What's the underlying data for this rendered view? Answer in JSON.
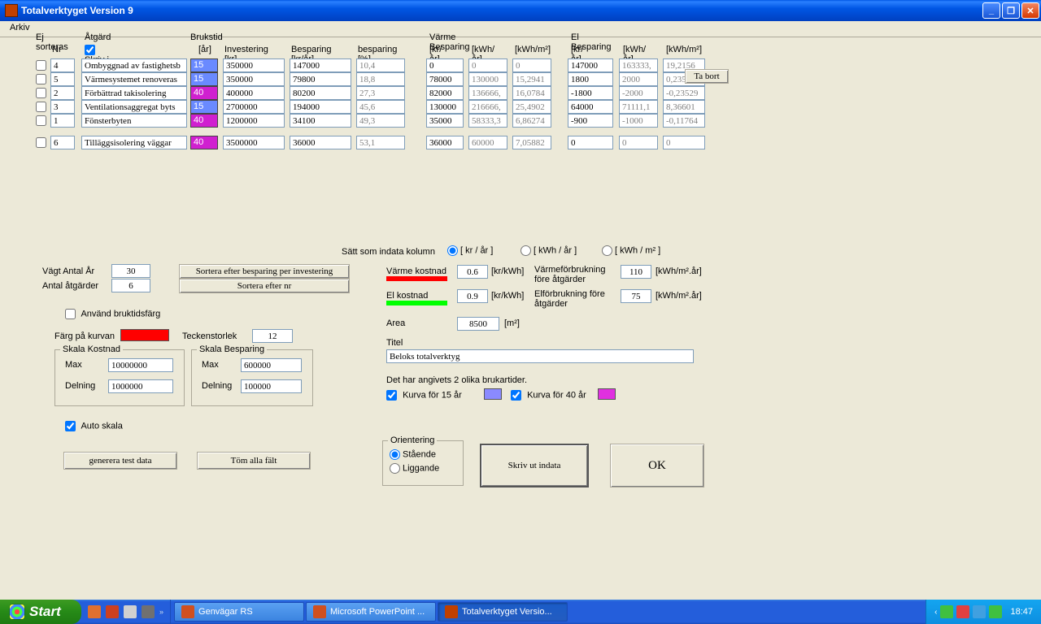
{
  "titlebar": {
    "text": "Totalverktyget Version 9"
  },
  "menu": {
    "arkiv": "Arkiv"
  },
  "headers": {
    "ej_sorteras": "Ej sorteras",
    "nr": "Nr",
    "atgard": "Åtgärd",
    "skriv_i_diagram": "Skriv i diagram",
    "brukstid": "Brukstid",
    "brukstid_ar": "[år]",
    "investering": "Investering [kr]",
    "besparing_kr": "Besparing [kr/år]",
    "besparing_pct": "besparing [%]",
    "varme_besparing": "Värme Besparing",
    "vb_kr": "[kr/år]",
    "vb_kwh_ar": "[kWh/år]",
    "vb_kwh_m2": "[kWh/m²]",
    "el_besparing": "El Besparing",
    "eb_kr": "[kr/år]",
    "eb_kwh_ar": "[kWh/år]",
    "eb_kwh_m2": "[kWh/m²]"
  },
  "rows": [
    {
      "nr": "4",
      "atgard": "Ombyggnad av fastighetsb",
      "bruk": "15",
      "brukcolor": "blue",
      "inv": "350000",
      "bkr": "147000",
      "bpct": "10,4",
      "vkr": "0",
      "vkwh": "0",
      "vkwhm": "0",
      "ekr": "147000",
      "ekwh": "163333,",
      "ekwhm": "19,2156"
    },
    {
      "nr": "5",
      "atgard": "Värmesystemet renoveras",
      "bruk": "15",
      "brukcolor": "blue",
      "inv": "350000",
      "bkr": "79800",
      "bpct": "18,8",
      "vkr": "78000",
      "vkwh": "130000",
      "vkwhm": "15,2941",
      "ekr": "1800",
      "ekwh": "2000",
      "ekwhm": "0,23529"
    },
    {
      "nr": "2",
      "atgard": "Förbättrad takisolering",
      "bruk": "40",
      "brukcolor": "purple",
      "inv": "400000",
      "bkr": "80200",
      "bpct": "27,3",
      "vkr": "82000",
      "vkwh": "136666,",
      "vkwhm": "16,0784",
      "ekr": "-1800",
      "ekwh": "-2000",
      "ekwhm": "-0,23529"
    },
    {
      "nr": "3",
      "atgard": "Ventilationsaggregat byts",
      "bruk": "15",
      "brukcolor": "blue",
      "inv": "2700000",
      "bkr": "194000",
      "bpct": "45,6",
      "vkr": "130000",
      "vkwh": "216666,",
      "vkwhm": "25,4902",
      "ekr": "64000",
      "ekwh": "71111,1",
      "ekwhm": "8,36601"
    },
    {
      "nr": "1",
      "atgard": "Fönsterbyten",
      "bruk": "40",
      "brukcolor": "purple",
      "inv": "1200000",
      "bkr": "34100",
      "bpct": "49,3",
      "vkr": "35000",
      "vkwh": "58333,3",
      "vkwhm": "6,86274",
      "ekr": "-900",
      "ekwh": "-1000",
      "ekwhm": "-0,11764"
    }
  ],
  "lastrow": {
    "nr": "6",
    "atgard": "Tilläggsisolering väggar",
    "bruk": "40",
    "brukcolor": "purple",
    "inv": "3500000",
    "bkr": "36000",
    "bpct": "53,1",
    "vkr": "36000",
    "vkwh": "60000",
    "vkwhm": "7,05882",
    "ekr": "0",
    "ekwh": "0",
    "ekwhm": "0"
  },
  "buttons": {
    "tabort": "Ta bort",
    "sortera_besparing": "Sortera efter besparing per investering",
    "sortera_nr": "Sortera efter nr",
    "generera": "generera test data",
    "tom": "Töm alla fält",
    "skriv_ut": "Skriv ut indata",
    "ok": "OK"
  },
  "settings": {
    "vagt_antal_ar_lbl": "Vägt Antal År",
    "vagt_antal_ar": "30",
    "antal_atgarder_lbl": "Antal åtgärder",
    "antal_atgarder": "6",
    "anvand_bruktidsfarg": "Använd bruktidsfärg",
    "farg_kurvan": "Färg på kurvan",
    "teckenstorlek_lbl": "Teckenstorlek",
    "teckenstorlek": "12",
    "auto_skala": "Auto skala"
  },
  "skala_kostnad": {
    "title": "Skala Kostnad",
    "max_lbl": "Max",
    "max": "10000000",
    "deln_lbl": "Delning",
    "deln": "1000000"
  },
  "skala_besparing": {
    "title": "Skala Besparing",
    "max_lbl": "Max",
    "max": "600000",
    "deln_lbl": "Delning",
    "deln": "100000"
  },
  "indata": {
    "satt_lbl": "Sätt som indata kolumn",
    "opt_kr": "[ kr / år ]",
    "opt_kwh": "[ kWh / år ]",
    "opt_kwhm": "[ kWh / m² ]",
    "varme_kostnad_lbl": "Värme kostnad",
    "varme_kostnad": "0.6",
    "kr_kwh": "[kr/kWh]",
    "el_kostnad_lbl": "El kostnad",
    "el_kostnad": "0.9",
    "varmefor_lbl": "Värmeförbrukning före åtgärder",
    "varmefor": "110",
    "kwhm2ar": "[kWh/m².år]",
    "elfor_lbl": "Elförbrukning före åtgärder",
    "elfor": "75",
    "area_lbl": "Area",
    "area": "8500",
    "m2": "[m²]",
    "titel_lbl": "Titel",
    "titel": "Beloks totalverktyg",
    "brukartider": "Det har angivets 2 olika brukartider.",
    "kurva15": "Kurva för 15 år",
    "kurva40": "Kurva för 40 år"
  },
  "orient": {
    "title": "Orientering",
    "staende": "Stående",
    "liggande": "Liggande"
  },
  "taskbar": {
    "start": "Start",
    "genvagar": "Genvägar RS",
    "powerpoint": "Microsoft PowerPoint ...",
    "totalverk": "Totalverktyget Versio...",
    "time": "18:47"
  }
}
